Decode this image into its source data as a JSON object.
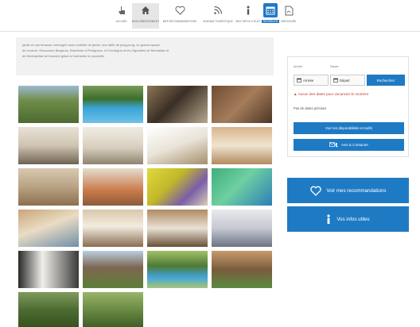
{
  "nav": {
    "items": [
      {
        "label": "Accueil",
        "icon": "hand-pointer-icon"
      },
      {
        "label": "Mon hébergement",
        "icon": "home-icon"
      },
      {
        "label": "Mes recommandations",
        "icon": "heart-icon"
      },
      {
        "label": "Agenda touristique",
        "icon": "rss-icon"
      },
      {
        "label": "Mes infos utiles",
        "icon": "info-icon"
      },
      {
        "label": "Réserver",
        "icon": "calendar-icon"
      },
      {
        "label": "Brochure",
        "icon": "pdf-icon"
      }
    ]
  },
  "description": {
    "lines": [
      "jardin et une terrasse ombragée avec mobilier de jardin, une table de ping-pong, un grand espace",
      "de verdure. Découvrez Bergerac, Brantôme et Périgueux. Ici Dordogne et les Vignobles de Montaillac et",
      "de Monbazillac se trouvent grâce à l’authentic le proximité."
    ]
  },
  "booking": {
    "arrival_label": "Arrivée",
    "departure_label": "Départ",
    "arrival_value": "Arrivée",
    "departure_value": "Départ",
    "search_label": "Rechercher",
    "warning": "Aucun des dates pour vacancier le moment",
    "no_price": "Pas de dates précises",
    "availability_label": "Voir les disponibilités et tarifs",
    "contact_label": "Avis & Contacter"
  },
  "actions": {
    "recommendations_label": "Voir mes recommandations",
    "info_label": "Vos infos utiles"
  },
  "colors": {
    "accent": "#1f7ac4",
    "warning": "#c0392b"
  }
}
